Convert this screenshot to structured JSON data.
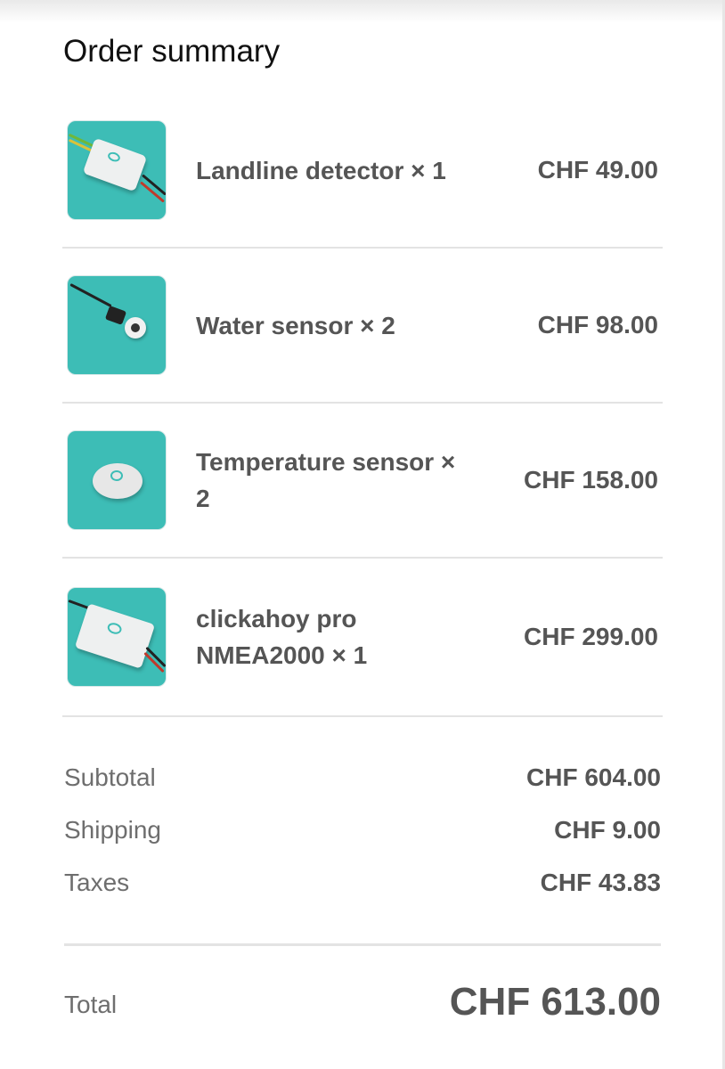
{
  "title": "Order summary",
  "items": [
    {
      "name": "Landline detector × 1",
      "price": "CHF 49.00",
      "icon": "landline-detector-image"
    },
    {
      "name": "Water sensor × 2",
      "price": "CHF 98.00",
      "icon": "water-sensor-image"
    },
    {
      "name": "Temperature sensor × 2",
      "price": "CHF 158.00",
      "icon": "temperature-sensor-image"
    },
    {
      "name": "clickahoy pro NMEA2000 × 1",
      "price": "CHF 299.00",
      "icon": "clickahoy-pro-image"
    }
  ],
  "summary": {
    "subtotal_label": "Subtotal",
    "subtotal_value": "CHF 604.00",
    "shipping_label": "Shipping",
    "shipping_value": "CHF 9.00",
    "taxes_label": "Taxes",
    "taxes_value": "CHF 43.83",
    "total_label": "Total",
    "total_value": "CHF 613.00"
  },
  "colors": {
    "thumbnail_bg": "#3dbdb6",
    "text_primary": "#555555",
    "text_muted": "#6e6e6e"
  }
}
